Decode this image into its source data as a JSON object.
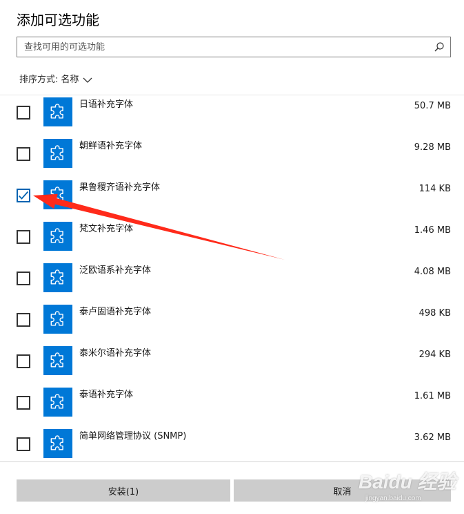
{
  "dialog": {
    "title": "添加可选功能"
  },
  "search": {
    "placeholder": "查找可用的可选功能",
    "value": "",
    "icon": "search-icon"
  },
  "sort": {
    "label": "排序方式:",
    "value": "名称",
    "icon": "chevron-down-icon"
  },
  "features": [
    {
      "name": "日语补充字体",
      "size": "50.7 MB",
      "checked": false
    },
    {
      "name": "朝鲜语补充字体",
      "size": "9.28 MB",
      "checked": false
    },
    {
      "name": "果鲁稷齐语补充字体",
      "size": "114 KB",
      "checked": true
    },
    {
      "name": "梵文补充字体",
      "size": "1.46 MB",
      "checked": false
    },
    {
      "name": "泛欧语系补充字体",
      "size": "4.08 MB",
      "checked": false
    },
    {
      "name": "泰卢固语补充字体",
      "size": "498 KB",
      "checked": false
    },
    {
      "name": "泰米尔语补充字体",
      "size": "294 KB",
      "checked": false
    },
    {
      "name": "泰语补充字体",
      "size": "1.61 MB",
      "checked": false
    },
    {
      "name": "简单网络管理协议 (SNMP)",
      "size": "3.62 MB",
      "checked": false
    }
  ],
  "feature_icon": "puzzle-piece-icon",
  "buttons": {
    "install": "安装(1)",
    "cancel": "取消"
  },
  "watermark": {
    "logo": "Baidu 经验",
    "url": "jingyan.baidu.com"
  },
  "colors": {
    "accent": "#0078d7",
    "button_bg": "#cccccc",
    "annotation_arrow": "#ff2a1a"
  }
}
